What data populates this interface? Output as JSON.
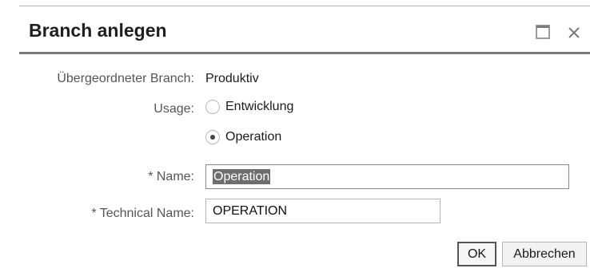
{
  "dialog": {
    "title": "Branch anlegen",
    "maximize_icon": "maximize-icon",
    "close_icon": "close-icon"
  },
  "form": {
    "parent_branch": {
      "label": "Übergeordneter Branch:",
      "value": "Produktiv"
    },
    "usage": {
      "label": "Usage:",
      "options": [
        {
          "label": "Entwicklung",
          "checked": false
        },
        {
          "label": "Operation",
          "checked": true
        }
      ]
    },
    "name": {
      "label": "* Name:",
      "value": "Operation",
      "selected": true
    },
    "technical_name": {
      "label": "* Technical Name:",
      "value": "OPERATION"
    }
  },
  "buttons": {
    "ok": "OK",
    "cancel": "Abbrechen"
  },
  "colors": {
    "title_rule": "#7a7a7a",
    "selection": "#6e6e6e"
  }
}
